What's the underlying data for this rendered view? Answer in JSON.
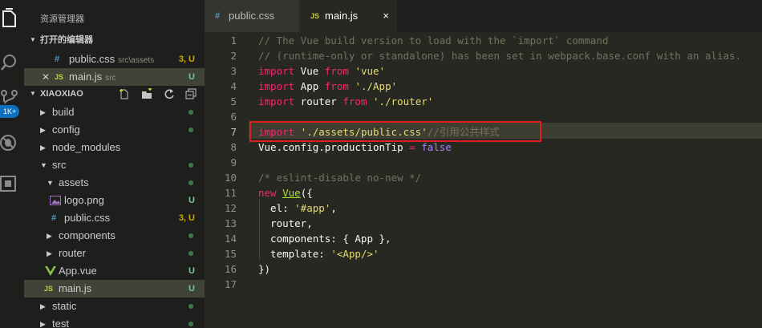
{
  "activity_bar": {
    "icons": [
      "files-icon",
      "search-icon",
      "source-control-icon",
      "debug-icon",
      "extensions-icon"
    ],
    "scm_badge": "1K+"
  },
  "sidebar": {
    "title": "资源管理器",
    "open_editors": {
      "header": "打开的编辑器",
      "items": [
        {
          "icon": "#",
          "name": "public.css",
          "path": "src\\assets",
          "status": "3, U"
        },
        {
          "icon": "JS",
          "name": "main.js",
          "path": "src",
          "status": "U"
        }
      ]
    },
    "project": {
      "header": "XIAOXIAO",
      "tree": [
        {
          "name": "build",
          "type": "folder",
          "expanded": false
        },
        {
          "name": "config",
          "type": "folder",
          "expanded": false
        },
        {
          "name": "node_modules",
          "type": "folder",
          "expanded": false
        },
        {
          "name": "src",
          "type": "folder",
          "expanded": true
        },
        {
          "name": "assets",
          "type": "folder",
          "expanded": true
        },
        {
          "name": "logo.png",
          "type": "image",
          "status": "U"
        },
        {
          "name": "public.css",
          "type": "css",
          "status": "3, U"
        },
        {
          "name": "components",
          "type": "folder",
          "expanded": false
        },
        {
          "name": "router",
          "type": "folder",
          "expanded": false
        },
        {
          "name": "App.vue",
          "type": "vue",
          "status": "U"
        },
        {
          "name": "main.js",
          "type": "js",
          "status": "U"
        },
        {
          "name": "static",
          "type": "folder",
          "expanded": false
        },
        {
          "name": "test",
          "type": "folder",
          "expanded": false
        }
      ]
    }
  },
  "tabs": [
    {
      "icon": "#",
      "label": "public.css",
      "active": false
    },
    {
      "icon": "JS",
      "label": "main.js",
      "active": true,
      "close": "×"
    }
  ],
  "editor": {
    "line_numbers": [
      "1",
      "2",
      "3",
      "4",
      "5",
      "6",
      "7",
      "8",
      "9",
      "10",
      "11",
      "12",
      "13",
      "14",
      "15",
      "16",
      "17"
    ],
    "active_line": "7",
    "lines": [
      [
        {
          "t": "c",
          "s": "// The Vue build version to load with the `import` command"
        }
      ],
      [
        {
          "t": "c",
          "s": "// (runtime-only or standalone) has been set in webpack.base.conf with an alias."
        }
      ],
      [
        {
          "t": "k",
          "s": "import"
        },
        {
          "t": "p",
          "s": " Vue "
        },
        {
          "t": "k",
          "s": "from"
        },
        {
          "t": "p",
          "s": " "
        },
        {
          "t": "s",
          "s": "'vue'"
        }
      ],
      [
        {
          "t": "k",
          "s": "import"
        },
        {
          "t": "p",
          "s": " App "
        },
        {
          "t": "k",
          "s": "from"
        },
        {
          "t": "p",
          "s": " "
        },
        {
          "t": "s",
          "s": "'./App'"
        }
      ],
      [
        {
          "t": "k",
          "s": "import"
        },
        {
          "t": "p",
          "s": " router "
        },
        {
          "t": "k",
          "s": "from"
        },
        {
          "t": "p",
          "s": " "
        },
        {
          "t": "s",
          "s": "'./router'"
        }
      ],
      [],
      [
        {
          "t": "k",
          "s": "import"
        },
        {
          "t": "p",
          "s": " "
        },
        {
          "t": "s",
          "s": "'./assets/public.css'"
        },
        {
          "t": "c",
          "s": "//引用公共样式"
        }
      ],
      [
        {
          "t": "p",
          "s": "Vue.config.productionTip "
        },
        {
          "t": "k",
          "s": "="
        },
        {
          "t": "p",
          "s": " "
        },
        {
          "t": "n",
          "s": "false"
        }
      ],
      [],
      [
        {
          "t": "c",
          "s": "/* eslint-disable no-new */"
        }
      ],
      [
        {
          "t": "k",
          "s": "new"
        },
        {
          "t": "p",
          "s": " "
        },
        {
          "t": "f",
          "s": "Vue"
        },
        {
          "t": "p",
          "s": "({"
        }
      ],
      [
        {
          "t": "p",
          "s": "  el: "
        },
        {
          "t": "s",
          "s": "'#app'"
        },
        {
          "t": "p",
          "s": ","
        }
      ],
      [
        {
          "t": "p",
          "s": "  router,"
        }
      ],
      [
        {
          "t": "p",
          "s": "  components: { App },"
        }
      ],
      [
        {
          "t": "p",
          "s": "  template: "
        },
        {
          "t": "s",
          "s": "'<App/>'"
        }
      ],
      [
        {
          "t": "p",
          "s": "})"
        }
      ],
      []
    ]
  },
  "colors": {
    "background": "#272822",
    "sidebar": "#1e1f1c",
    "keyword": "#f92672",
    "string": "#e6db74",
    "comment": "#75715e",
    "function": "#a6e22e",
    "constant": "#ae81ff",
    "git_untracked": "#73c991",
    "annotation_box": "#e02020"
  }
}
